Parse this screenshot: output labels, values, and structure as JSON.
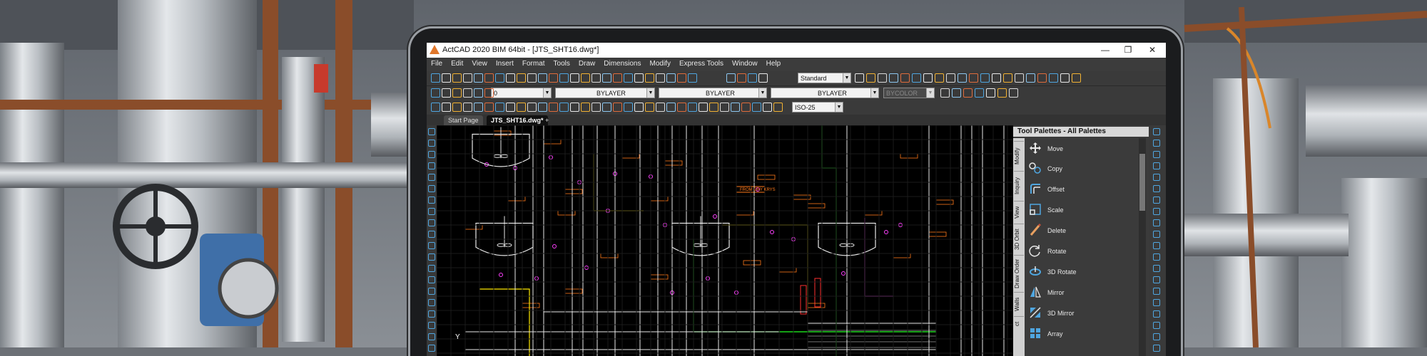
{
  "window": {
    "title": "ActCAD 2020 BIM 64bit - [JTS_SHT16.dwg*]",
    "minimize": "—",
    "maximize": "❐",
    "close": "✕"
  },
  "menu": [
    "File",
    "Edit",
    "View",
    "Insert",
    "Format",
    "Tools",
    "Draw",
    "Dimensions",
    "Modify",
    "Express Tools",
    "Window",
    "Help"
  ],
  "toolbar": {
    "text_style": "Standard",
    "layer": "0",
    "color": "BYLAYER",
    "linetype": "BYLAYER",
    "lineweight": "BYLAYER",
    "plot_style": "BYCOLOR",
    "dim_style": "ISO-25"
  },
  "tabs": [
    {
      "label": "Start Page"
    },
    {
      "label": "JTS_SHT16.dwg*"
    }
  ],
  "new_tab": "+",
  "palette": {
    "title": "Tool Palettes - All Palettes",
    "tabs": [
      "Modify",
      "Inquiry",
      "View",
      "3D Orbit",
      "Draw Order",
      "Walls",
      "ct"
    ],
    "items": [
      {
        "label": "Move",
        "icon": "move-icon"
      },
      {
        "label": "Copy",
        "icon": "copy-icon"
      },
      {
        "label": "Offset",
        "icon": "offset-icon"
      },
      {
        "label": "Scale",
        "icon": "scale-icon"
      },
      {
        "label": "Delete",
        "icon": "delete-icon"
      },
      {
        "label": "Rotate",
        "icon": "rotate-icon"
      },
      {
        "label": "3D Rotate",
        "icon": "3d-rotate-icon"
      },
      {
        "label": "Mirror",
        "icon": "mirror-icon"
      },
      {
        "label": "3D Mirror",
        "icon": "3d-mirror-icon"
      },
      {
        "label": "Array",
        "icon": "array-icon"
      }
    ]
  },
  "drawing": {
    "axis_y_label": "Y",
    "frame_label": "FROM DRY KRYS"
  },
  "colors": {
    "accent": "#4fa6e0",
    "cad_yellow": "#ffea00",
    "cad_magenta": "#ff40ff",
    "cad_green": "#22ff22",
    "cad_orange": "#ff7a1a"
  }
}
